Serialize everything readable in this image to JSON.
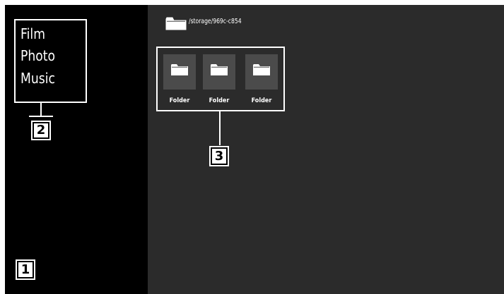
{
  "sidebar": {
    "menu": [
      {
        "label": "Film"
      },
      {
        "label": "Photo"
      },
      {
        "label": "Music"
      }
    ],
    "badge_1": "1",
    "badge_2": "2"
  },
  "content": {
    "path": "/storage/969c-c854",
    "path_icon": "folder-icon",
    "folders": [
      {
        "label": "Folder",
        "icon": "folder-icon"
      },
      {
        "label": "Folder",
        "icon": "folder-icon"
      },
      {
        "label": "Folder",
        "icon": "folder-icon"
      }
    ],
    "badge_3": "3"
  },
  "colors": {
    "sidebar_bg": "#000000",
    "content_bg": "#2b2b2b",
    "tile_bg": "#4b4b4b",
    "highlight": "#ffffff"
  }
}
